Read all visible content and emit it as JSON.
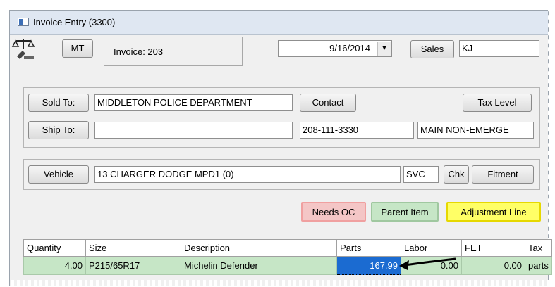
{
  "window": {
    "title": "Invoice Entry (3300)"
  },
  "toolbar": {
    "mt_label": "MT",
    "invoice_label": "Invoice: 203",
    "date_value": "9/16/2014",
    "sales_label": "Sales",
    "salesperson_value": "KJ"
  },
  "customer": {
    "sold_to_label": "Sold To:",
    "sold_to_value": "MIDDLETON POLICE DEPARTMENT",
    "contact_label": "Contact",
    "tax_level_label": "Tax Level",
    "ship_to_label": "Ship To:",
    "ship_to_value": "",
    "phone_value": "208-111-3330",
    "phone_desc_value": "MAIN NON-EMERGE"
  },
  "vehicle": {
    "vehicle_label": "Vehicle",
    "vehicle_value": "13 CHARGER DODGE MPD1 (0)",
    "svc_value": "SVC",
    "chk_label": "Chk",
    "fitment_label": "Fitment"
  },
  "status_tags": {
    "needs_oc": "Needs OC",
    "parent_item": "Parent Item",
    "adjustment_line": "Adjustment Line"
  },
  "colors": {
    "needs_oc_bg": "#f4c6c6",
    "parent_item_bg": "#c6e6c6",
    "adjustment_line_bg": "#ffff66",
    "selection": "#1b6bd1",
    "row_bg": "#c6e6c6"
  },
  "lines": {
    "headers": [
      "Quantity",
      "Size",
      "Description",
      "Parts",
      "Labor",
      "FET",
      "Tax"
    ],
    "rows": [
      {
        "quantity": "4.00",
        "size": "P215/65R17",
        "description": "Michelin Defender",
        "parts": "167.99",
        "labor": "0.00",
        "fet": "0.00",
        "tax": "parts"
      }
    ]
  },
  "icons": [
    "app-window-icon",
    "scale-icon",
    "dropdown-arrow-icon",
    "arrow-annotation-icon"
  ]
}
